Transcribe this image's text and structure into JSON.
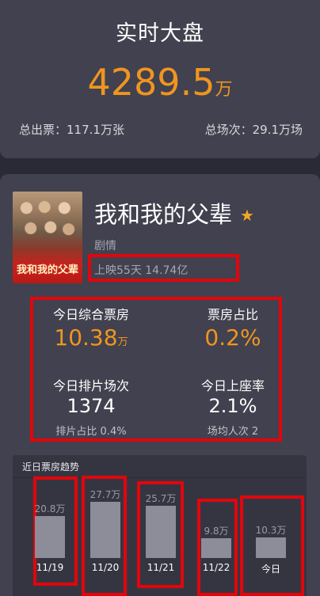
{
  "realtime": {
    "title": "实时大盘",
    "total_gross_value": "4289.5",
    "total_gross_unit": "万",
    "tickets_text": "总出票：117.1万张",
    "shows_text": "总场次：29.1万场"
  },
  "movie": {
    "poster_title": "我和我的父辈",
    "name": "我和我的父辈",
    "genre": "剧情",
    "release_info": "上映55天  14.74亿",
    "today_gross_label": "今日综合票房",
    "today_gross_value": "10.38",
    "today_gross_unit": "万",
    "gross_share_label": "票房占比",
    "gross_share_value": "0.2%",
    "shows_label": "今日排片场次",
    "shows_value": "1374",
    "shows_share_text": "排片占比 0.4%",
    "occupancy_label": "今日上座率",
    "occupancy_value": "2.1%",
    "avg_audience_text": "场均人次 2"
  },
  "trend": {
    "title": "近日票房趋势",
    "bar_color": "#8d8d99"
  },
  "highlight_color": "#e3050b",
  "accent_color": "#f0951f",
  "chart_data": {
    "type": "bar",
    "title": "近日票房趋势",
    "categories": [
      "11/19",
      "11/20",
      "11/21",
      "11/22",
      "今日"
    ],
    "values": [
      20.8,
      27.7,
      25.7,
      9.8,
      10.3
    ],
    "value_labels": [
      "20.8万",
      "27.7万",
      "25.7万",
      "9.8万",
      "10.3万"
    ],
    "unit": "万"
  }
}
